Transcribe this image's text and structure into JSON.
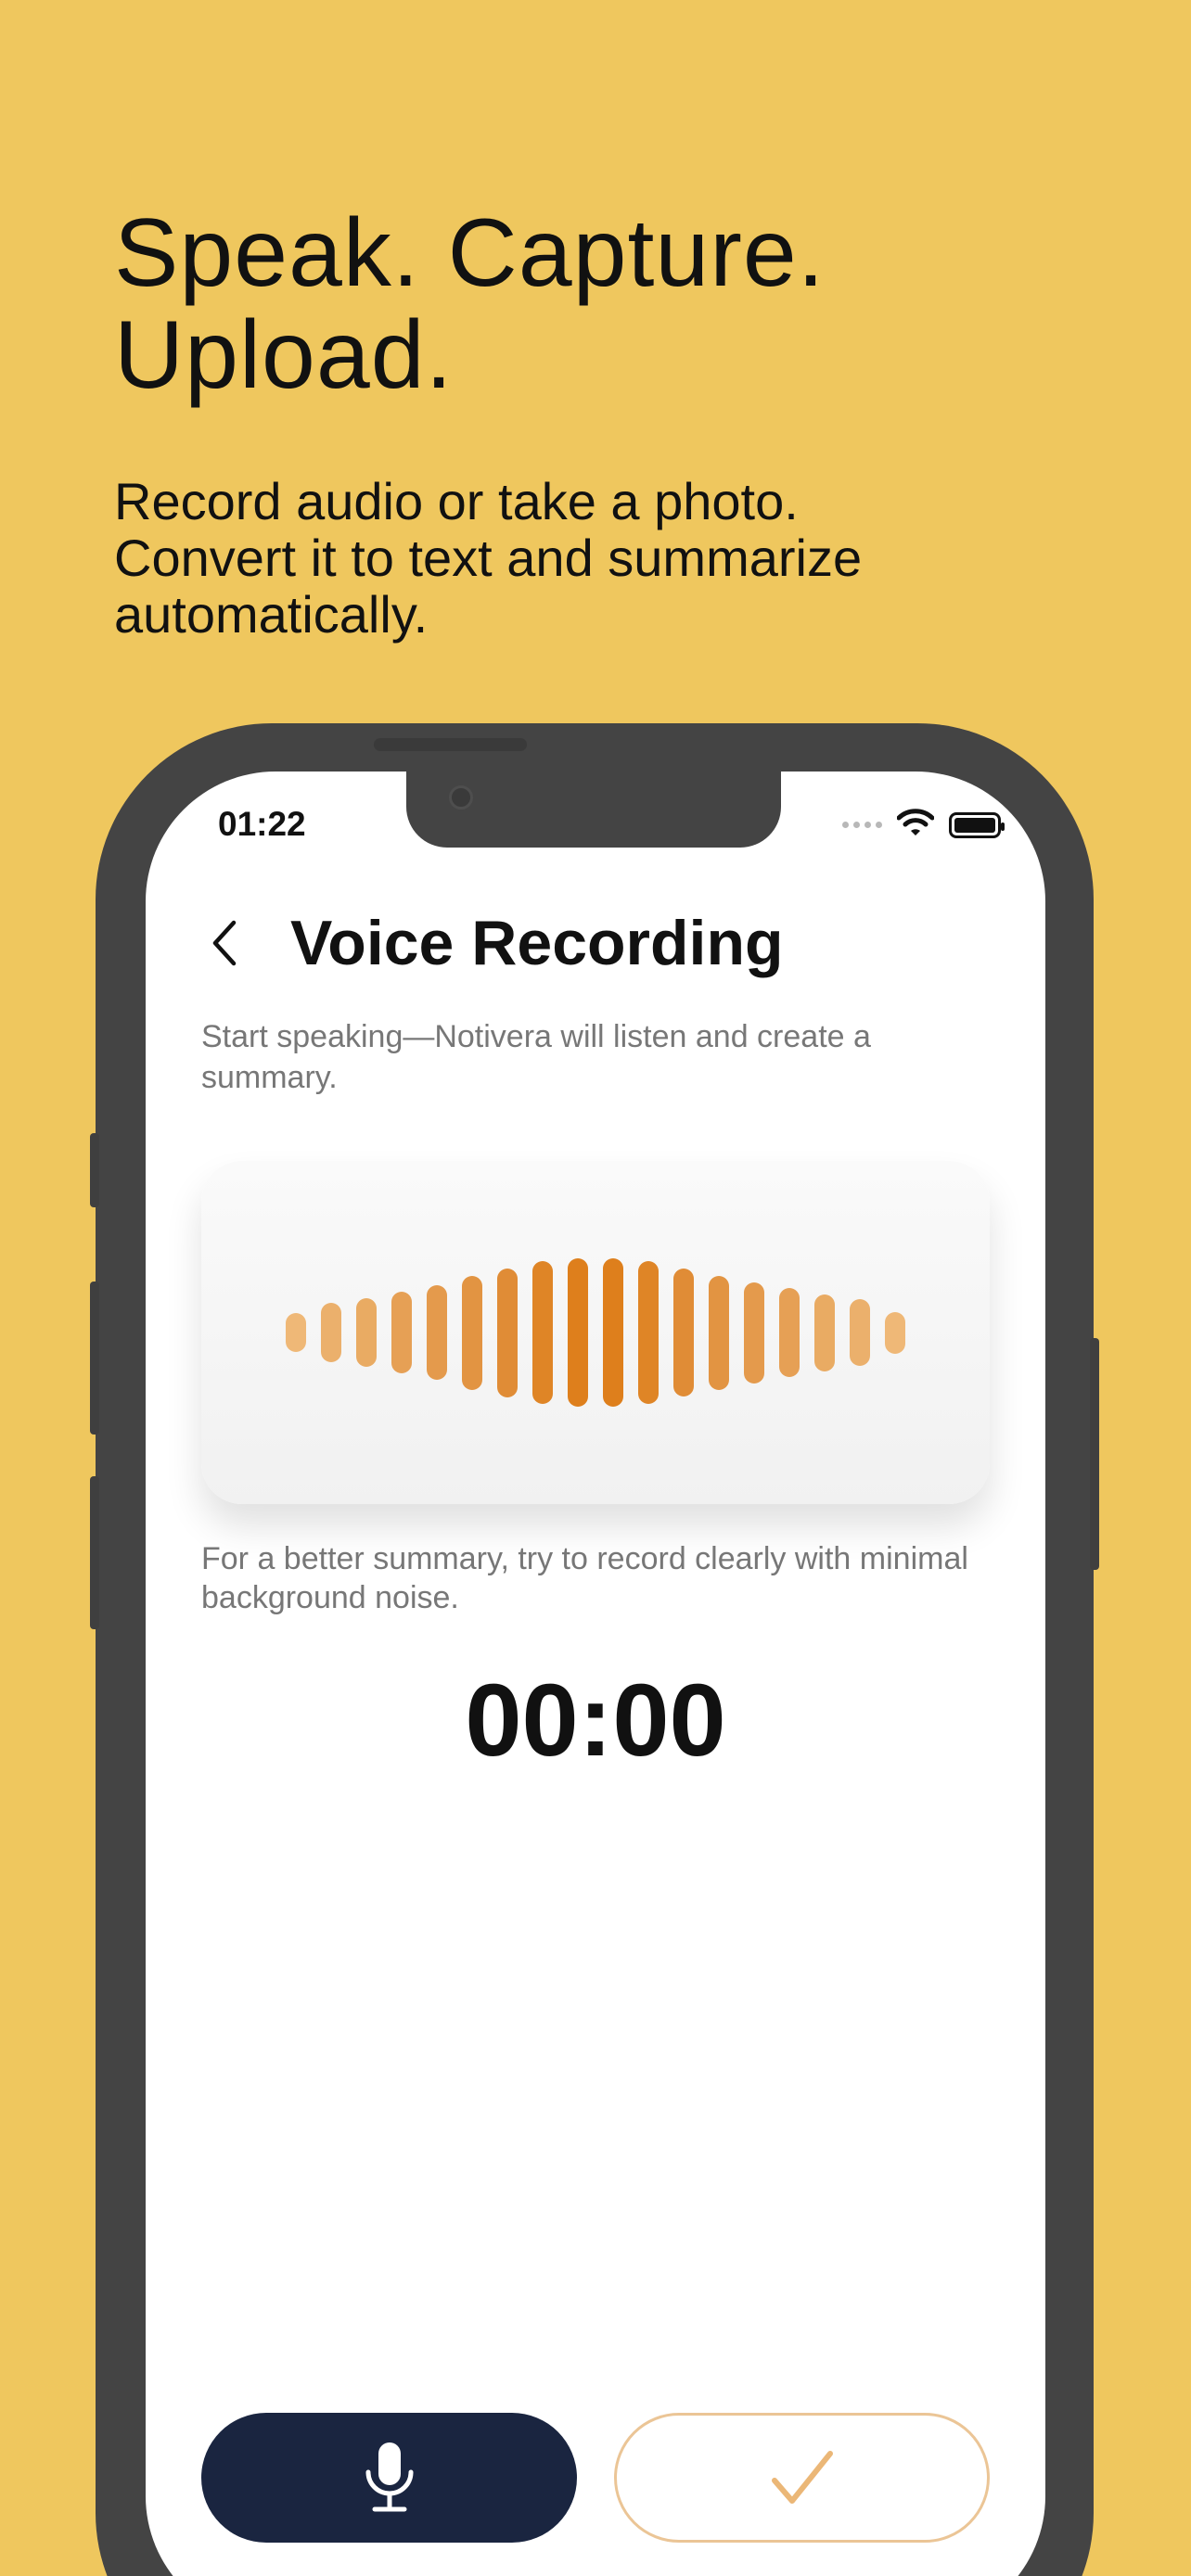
{
  "marketing": {
    "headline_line1": "Speak. Capture.",
    "headline_line2": "Upload.",
    "subhead_line1": "Record audio or take a photo.",
    "subhead_line2": "Convert it to text and summarize",
    "subhead_line3": "automatically."
  },
  "status_bar": {
    "time": "01:22",
    "icons": [
      "signal-dots-icon",
      "wifi-icon",
      "battery-icon"
    ]
  },
  "screen": {
    "back_icon": "chevron-left-icon",
    "title": "Voice Recording",
    "intro": "Start speaking—Notivera will listen and create a summary.",
    "tip": "For a better summary, try to record clearly with minimal background noise.",
    "timer": "00:00"
  },
  "waveform": {
    "levels": [
      0.26,
      0.4,
      0.46,
      0.55,
      0.64,
      0.77,
      0.87,
      0.96,
      1.0,
      1.0,
      0.96,
      0.86,
      0.77,
      0.68,
      0.6,
      0.52,
      0.45,
      0.28
    ],
    "colors": [
      "#EFB877",
      "#EBB06C",
      "#E9AB63",
      "#E6A055",
      "#E49A4C",
      "#E29442",
      "#E08C36",
      "#DF8526",
      "#DE7F1C",
      "#DE7F1C",
      "#DF8526",
      "#E08C36",
      "#E29442",
      "#E49A4C",
      "#E6A055",
      "#E9AB63",
      "#EBB06C",
      "#EFB877"
    ]
  },
  "actions": {
    "record_icon": "microphone-icon",
    "done_icon": "checkmark-icon"
  },
  "colors": {
    "background": "#EFC75E",
    "record_button": "#1a2540",
    "accent": "#DE7F1C",
    "done_border": "#EBC596"
  }
}
